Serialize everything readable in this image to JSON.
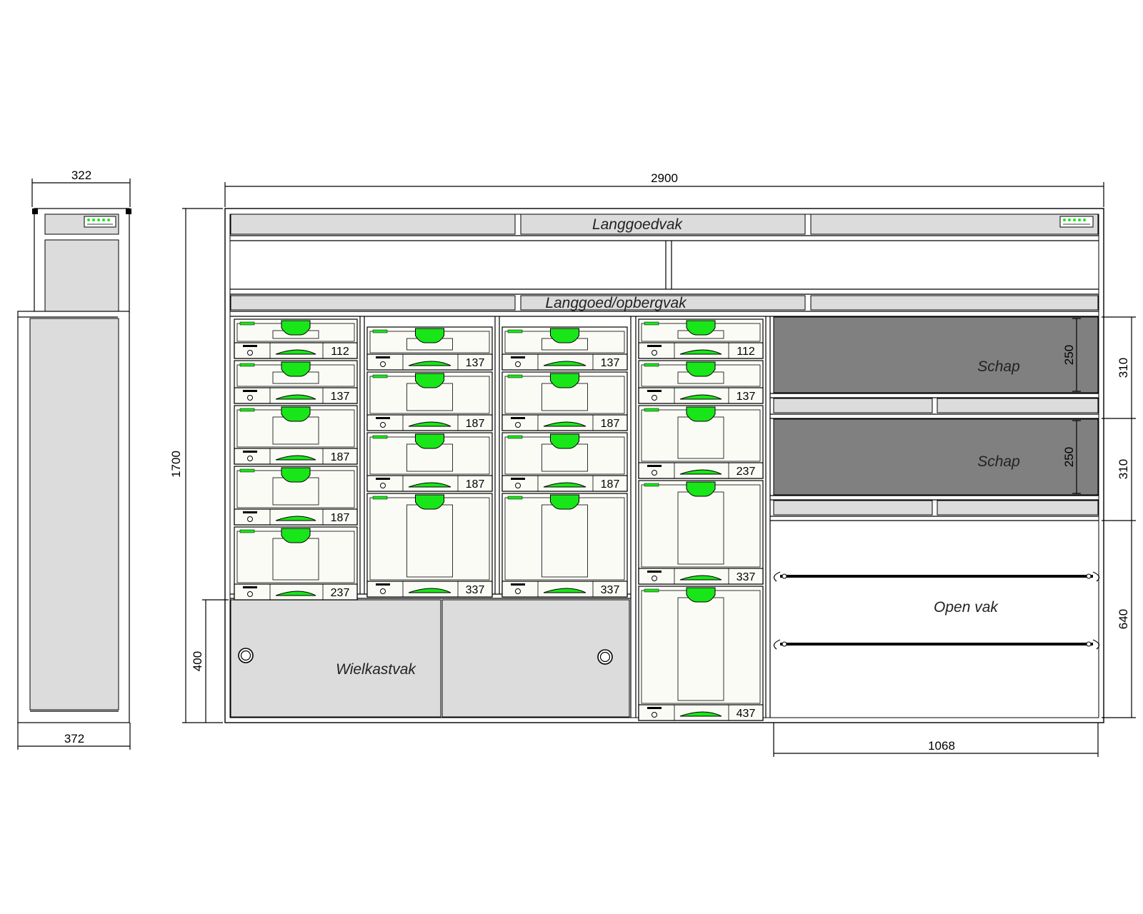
{
  "dimensions": {
    "side_top_depth": "322",
    "side_bottom_depth": "372",
    "overall_width": "2900",
    "overall_height": "1700",
    "wheel_box_height": "400",
    "open_section_width": "1068",
    "shelf_height_1": "250",
    "shelf_height_2": "250",
    "shelf_pitch_1": "310",
    "shelf_pitch_2": "310",
    "open_compartment_height": "640"
  },
  "labels": {
    "long_goods": "Langgoedvak",
    "long_goods_storage": "Langgoed/opbergvak",
    "wheel_box": "Wielkastvak",
    "shelf_1": "Schap",
    "shelf_2": "Schap",
    "open_compartment": "Open vak"
  },
  "columns": [
    {
      "id": "col-1",
      "systainers": [
        "112",
        "137",
        "187",
        "187",
        "237"
      ]
    },
    {
      "id": "col-2",
      "systainers": [
        "137",
        "187",
        "187",
        "337"
      ]
    },
    {
      "id": "col-3",
      "systainers": [
        "137",
        "187",
        "187",
        "337"
      ]
    },
    {
      "id": "col-4",
      "systainers": [
        "112",
        "137",
        "237",
        "337",
        "437"
      ]
    }
  ],
  "colors": {
    "panel_fill": "#dcdcdc",
    "shelf_fill": "#808080",
    "systainer_fill": "#fbfbf6",
    "handle_green": "#19e619"
  }
}
